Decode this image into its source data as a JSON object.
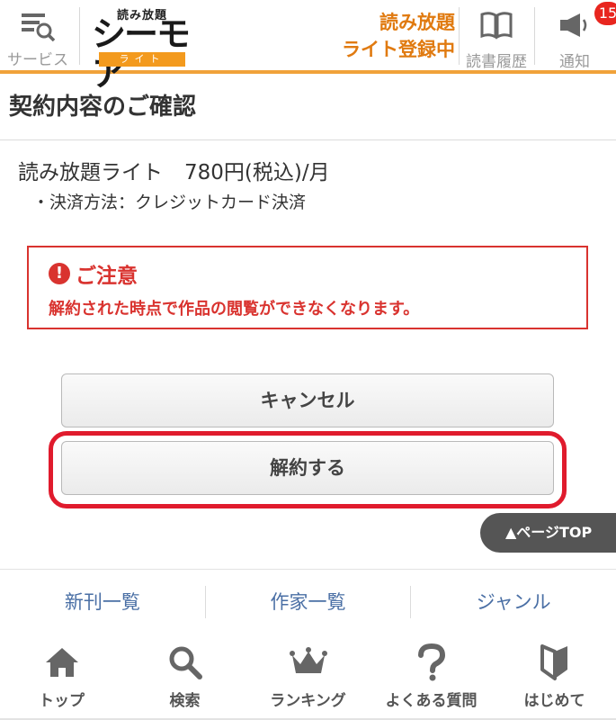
{
  "header": {
    "service_label": "サービス",
    "logo_small": "読み放題",
    "logo_big": "シーモア",
    "logo_lite": "ライト",
    "plan_status_line1": "読み放題",
    "plan_status_line2": "ライト登録中",
    "history_label": "読書履歴",
    "notice_label": "通知",
    "notice_count": "15"
  },
  "page": {
    "title": "契約内容のご確認",
    "plan_name": "読み放題ライト",
    "plan_price": "780円(税込)/月",
    "payment_method": "・決済方法：クレジットカード決済"
  },
  "caution": {
    "icon": "!",
    "heading": "ご注意",
    "message": "解約された時点で作品の閲覧ができなくなります。"
  },
  "buttons": {
    "cancel": "キャンセル",
    "terminate": "解約する",
    "page_top": "▲ページTOP"
  },
  "links": [
    "新刊一覧",
    "作家一覧",
    "ジャンル"
  ],
  "bottom_nav": [
    {
      "label": "トップ",
      "icon": "home-icon"
    },
    {
      "label": "検索",
      "icon": "search-icon"
    },
    {
      "label": "ランキング",
      "icon": "crown-icon"
    },
    {
      "label": "よくある質問",
      "icon": "question-icon"
    },
    {
      "label": "はじめて",
      "icon": "beginner-mark-icon"
    }
  ],
  "colors": {
    "accent_orange": "#f0a23a",
    "plan_orange": "#e07a10",
    "caution_red": "#d9332f",
    "highlight_red": "#e01b2d",
    "link_blue": "#4a6fa5",
    "badge_red": "#e8261f"
  }
}
